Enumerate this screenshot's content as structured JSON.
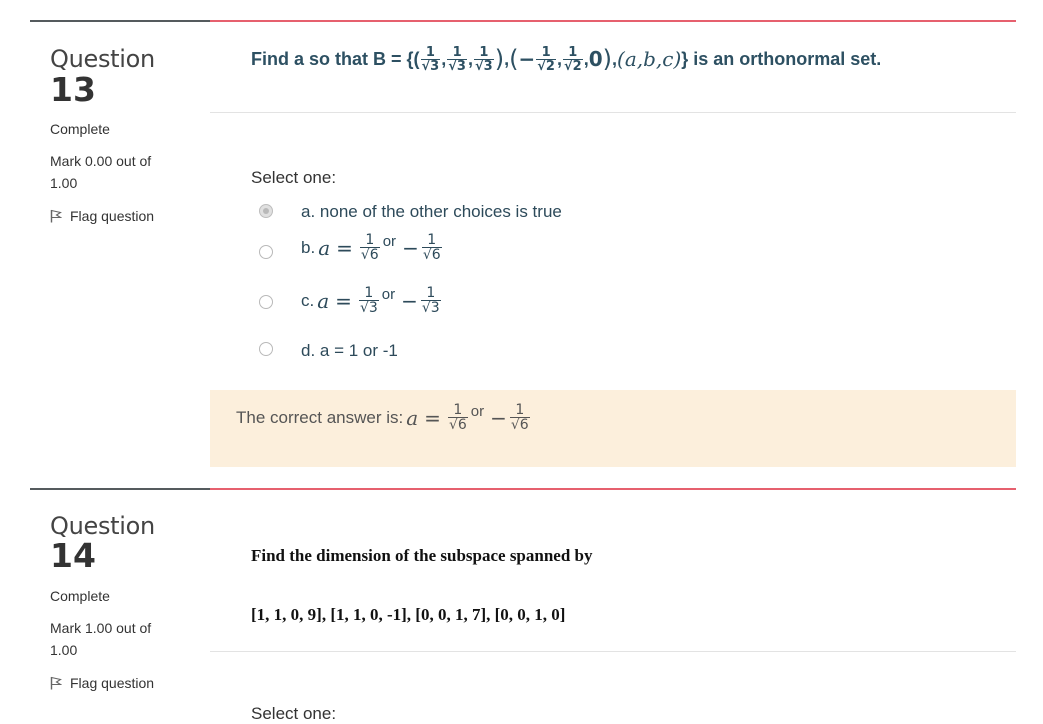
{
  "q13": {
    "label": "Question",
    "number": "13",
    "state": "Complete",
    "mark": "Mark 0.00 out of 1.00",
    "flag": "Flag question",
    "text_prefix": "Find a so that B = {(",
    "frac_num": "1",
    "den_sqrt3": "√3",
    "den_sqrt2": "√2",
    "minus": "−",
    "comma": ",",
    "zero": "0",
    "abc": "(a,b,c)",
    "text_suffix": "} is an orthonormal set.",
    "select_one": "Select one:",
    "options": [
      {
        "letter": "a.",
        "text": "none of the other choices is true",
        "selected": true
      },
      {
        "letter": "b.",
        "var": "a",
        "eq": "=",
        "or": "or",
        "den": "√6",
        "selected": false
      },
      {
        "letter": "c.",
        "var": "a",
        "eq": "=",
        "or": "or",
        "den": "√3",
        "selected": false
      },
      {
        "letter": "d.",
        "text": "a = 1 or -1",
        "selected": false
      }
    ],
    "correct_prefix": "The correct answer is:",
    "correct_var": "a",
    "correct_eq": "=",
    "correct_or": "or",
    "correct_den": "√6"
  },
  "q14": {
    "label": "Question",
    "number": "14",
    "state": "Complete",
    "mark": "Mark 1.00 out of 1.00",
    "flag": "Flag question",
    "text_line1": "Find the dimension of the subspace spanned by",
    "text_line2": "[1, 1, 0, 9], [1, 1, 0, -1], [0, 0, 1, 7], [0, 0, 1, 0]",
    "select_partial": "Select one:"
  },
  "colors": {
    "accent_rule": "#e6606e",
    "feedback_bg": "#fcefdc",
    "question_text": "#2d5062"
  },
  "icons": {
    "flag": "flag-icon",
    "radio": "radio-icon"
  }
}
